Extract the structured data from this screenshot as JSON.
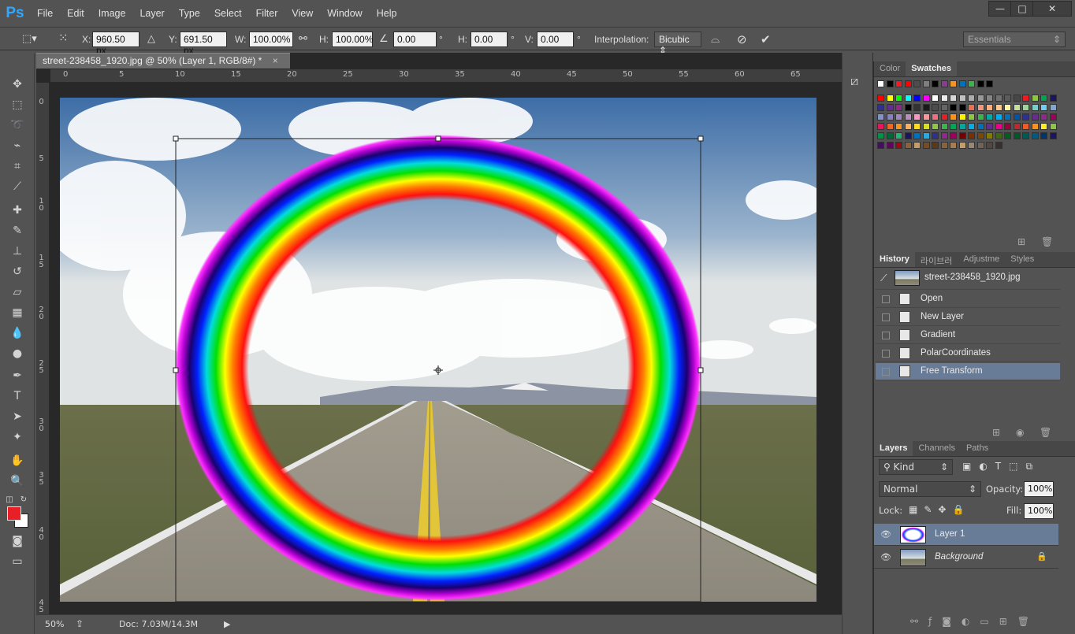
{
  "app": {
    "logo": "Ps"
  },
  "menu": [
    "File",
    "Edit",
    "Image",
    "Layer",
    "Type",
    "Select",
    "Filter",
    "View",
    "Window",
    "Help"
  ],
  "window_controls": {
    "minimize": "—",
    "restore": "□",
    "close": "✕"
  },
  "options": {
    "x_label": "X:",
    "x_value": "960.50 px",
    "y_label": "Y:",
    "y_value": "691.50 px",
    "w_label": "W:",
    "w_value": "100.00%",
    "h_label": "H:",
    "h_value": "100.00%",
    "angle_value": "0.00",
    "deg": "°",
    "hskew_label": "H:",
    "hskew_value": "0.00",
    "vskew_label": "V:",
    "vskew_value": "0.00",
    "interp_label": "Interpolation:",
    "interp_value": "Bicubic",
    "workspace": "Essentials"
  },
  "document": {
    "tab_title": "street-238458_1920.jpg @ 50% (Layer 1, RGB/8#) *",
    "close": "×",
    "ruler_top": [
      "0",
      "5",
      "10",
      "15",
      "20",
      "25",
      "30",
      "35",
      "40",
      "45",
      "50",
      "55",
      "60",
      "65"
    ],
    "ruler_left": [
      "0",
      "5",
      "1 0",
      "1 5",
      "2 0",
      "2 5",
      "3 0",
      "3 5",
      "4 0",
      "4 5"
    ]
  },
  "status": {
    "zoom": "50%",
    "doc": "Doc: 7.03M/14.3M"
  },
  "swatch_panel": {
    "tabs": [
      "Color",
      "Swatches"
    ],
    "active": "Swatches",
    "colors": [
      "#ffffff",
      "#000000",
      "#ed1c24",
      "#ff0000",
      "#4d4d4d",
      "#7f7f7f",
      "#000000",
      "#8c3b95",
      "#f7931e",
      "#0072bc",
      "#39b54a",
      "#000000",
      "#000000",
      "#ff0000",
      "#ffff00",
      "#00ff00",
      "#00ffff",
      "#0000ff",
      "#ff00ff",
      "#ffffff",
      "#ebebeb",
      "#d7d7d7",
      "#c2c2c2",
      "#adadad",
      "#999999",
      "#858585",
      "#707070",
      "#5c5c5c",
      "#474747",
      "#ed1c24",
      "#8dc63f",
      "#00a651",
      "#1b1464",
      "#2e3192",
      "#662d91",
      "#92278f",
      "#000000",
      "#333333",
      "#1a1a1a",
      "#4d4d4d",
      "#666666",
      "#000000",
      "#000000",
      "#f26c4f",
      "#f69679",
      "#f9ad81",
      "#fdc68a",
      "#fff799",
      "#c4df9b",
      "#a3d39c",
      "#7accc8",
      "#6dcff6",
      "#7da7d9",
      "#8393ca",
      "#8781bd",
      "#a186be",
      "#bd8cbf",
      "#f49ac1",
      "#f5989d",
      "#f26d7d",
      "#ed1c24",
      "#f7941d",
      "#fff200",
      "#8dc73f",
      "#39b54a",
      "#00a99d",
      "#00aeef",
      "#0072bc",
      "#0054a6",
      "#2e3192",
      "#662d91",
      "#92278f",
      "#9e005d",
      "#ed145b",
      "#f26522",
      "#f7941d",
      "#fbaf5d",
      "#ffde17",
      "#d7df23",
      "#8dc63f",
      "#39b54a",
      "#00a651",
      "#00a99d",
      "#00aeef",
      "#0072bc",
      "#662d91",
      "#ec008c",
      "#9e0039",
      "#c1272d",
      "#f15a24",
      "#f7931e",
      "#fcee21",
      "#8cc63f",
      "#009245",
      "#006837",
      "#22b573",
      "#1b1464",
      "#0071bc",
      "#29abe2",
      "#2e3192",
      "#93278f",
      "#9e005d",
      "#790000",
      "#7b2e00",
      "#7d4900",
      "#827b00",
      "#406618",
      "#005e20",
      "#005826",
      "#005952",
      "#005b7f",
      "#003471",
      "#1b1464",
      "#440e62",
      "#630460",
      "#9e0b0f",
      "#8c6239",
      "#c69c6d",
      "#754c24",
      "#603813",
      "#8c6239",
      "#a67c52",
      "#c69c6d",
      "#998675",
      "#736357",
      "#534741",
      "#362f2d"
    ]
  },
  "history_panel": {
    "tabs": [
      "History",
      "라이브러",
      "Adjustme",
      "Styles"
    ],
    "active": "History",
    "snapshot": "street-238458_1920.jpg",
    "items": [
      "Open",
      "New Layer",
      "Gradient",
      "PolarCoordinates",
      "Free Transform"
    ]
  },
  "layers_panel": {
    "tabs": [
      "Layers",
      "Channels",
      "Paths"
    ],
    "active": "Layers",
    "kind": "Kind",
    "blend": "Normal",
    "opacity_label": "Opacity:",
    "opacity": "100%",
    "lock_label": "Lock:",
    "fill_label": "Fill:",
    "fill": "100%",
    "layers": [
      "Layer 1",
      "Background"
    ]
  }
}
